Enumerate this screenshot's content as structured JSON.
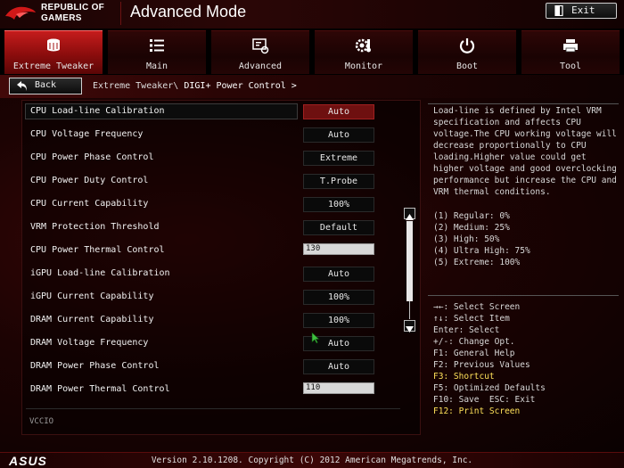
{
  "header": {
    "brand_line1": "REPUBLIC OF",
    "brand_line2": "GAMERS",
    "mode_title": "Advanced Mode",
    "exit_label": "Exit"
  },
  "tabs": [
    {
      "label": "Extreme Tweaker",
      "icon": "tweaker-icon",
      "active": true
    },
    {
      "label": "Main",
      "icon": "list-icon",
      "active": false
    },
    {
      "label": "Advanced",
      "icon": "advanced-icon",
      "active": false
    },
    {
      "label": "Monitor",
      "icon": "monitor-gear-icon",
      "active": false
    },
    {
      "label": "Boot",
      "icon": "power-icon",
      "active": false
    },
    {
      "label": "Tool",
      "icon": "printer-tool-icon",
      "active": false
    }
  ],
  "nav": {
    "back_label": "Back",
    "breadcrumb_path": "Extreme Tweaker\\",
    "breadcrumb_current": "DIGI+ Power Control >"
  },
  "settings": [
    {
      "label": "CPU Load-line Calibration",
      "value": "Auto",
      "type": "select",
      "selected": true
    },
    {
      "label": "CPU Voltage Frequency",
      "value": "Auto",
      "type": "select"
    },
    {
      "label": "CPU Power Phase Control",
      "value": "Extreme",
      "type": "select"
    },
    {
      "label": "CPU Power Duty Control",
      "value": "T.Probe",
      "type": "select"
    },
    {
      "label": "CPU Current Capability",
      "value": "100%",
      "type": "select"
    },
    {
      "label": "VRM Protection Threshold",
      "value": "Default",
      "type": "select"
    },
    {
      "label": "CPU Power Thermal Control",
      "value": "130",
      "type": "input"
    },
    {
      "label": "iGPU Load-line Calibration",
      "value": "Auto",
      "type": "select"
    },
    {
      "label": "iGPU Current Capability",
      "value": "100%",
      "type": "select"
    },
    {
      "label": "DRAM Current Capability",
      "value": "100%",
      "type": "select"
    },
    {
      "label": "DRAM Voltage Frequency",
      "value": "Auto",
      "type": "select"
    },
    {
      "label": "DRAM Power Phase Control",
      "value": "Auto",
      "type": "select"
    },
    {
      "label": "DRAM Power Thermal Control",
      "value": "110",
      "type": "input"
    }
  ],
  "footer_item": "VCCIO",
  "help": {
    "lines": [
      "Load-line is defined by Intel VRM",
      "specification and affects CPU",
      "voltage.The CPU working voltage will",
      "decrease proportionally to CPU",
      "loading.Higher value could get",
      "higher voltage and good overclocking",
      "performance but increase the CPU and",
      "VRM thermal conditions."
    ],
    "levels": [
      "(1) Regular: 0%",
      "(2) Medium: 25%",
      "(3) High: 50%",
      "(4) Ultra High: 75%",
      "(5) Extreme: 100%"
    ]
  },
  "keys": [
    {
      "text": "→←: Select Screen",
      "highlight": false
    },
    {
      "text": "↑↓: Select Item",
      "highlight": false
    },
    {
      "text": "Enter: Select",
      "highlight": false
    },
    {
      "text": "+/-: Change Opt.",
      "highlight": false
    },
    {
      "text": "F1: General Help",
      "highlight": false
    },
    {
      "text": "F2: Previous Values",
      "highlight": false
    },
    {
      "text": "F3: Shortcut",
      "highlight": true
    },
    {
      "text": "F5: Optimized Defaults",
      "highlight": false
    },
    {
      "text": "F10: Save  ESC: Exit",
      "highlight": false
    },
    {
      "text": "F12: Print Screen",
      "highlight": true
    }
  ],
  "bottom": {
    "logo": "ASUS",
    "version": "Version 2.10.1208. Copyright (C) 2012 American Megatrends, Inc."
  },
  "colors": {
    "accent_red": "#c51c1c",
    "selected_value": "#6e1010",
    "highlight_key": "#ffe25a"
  }
}
